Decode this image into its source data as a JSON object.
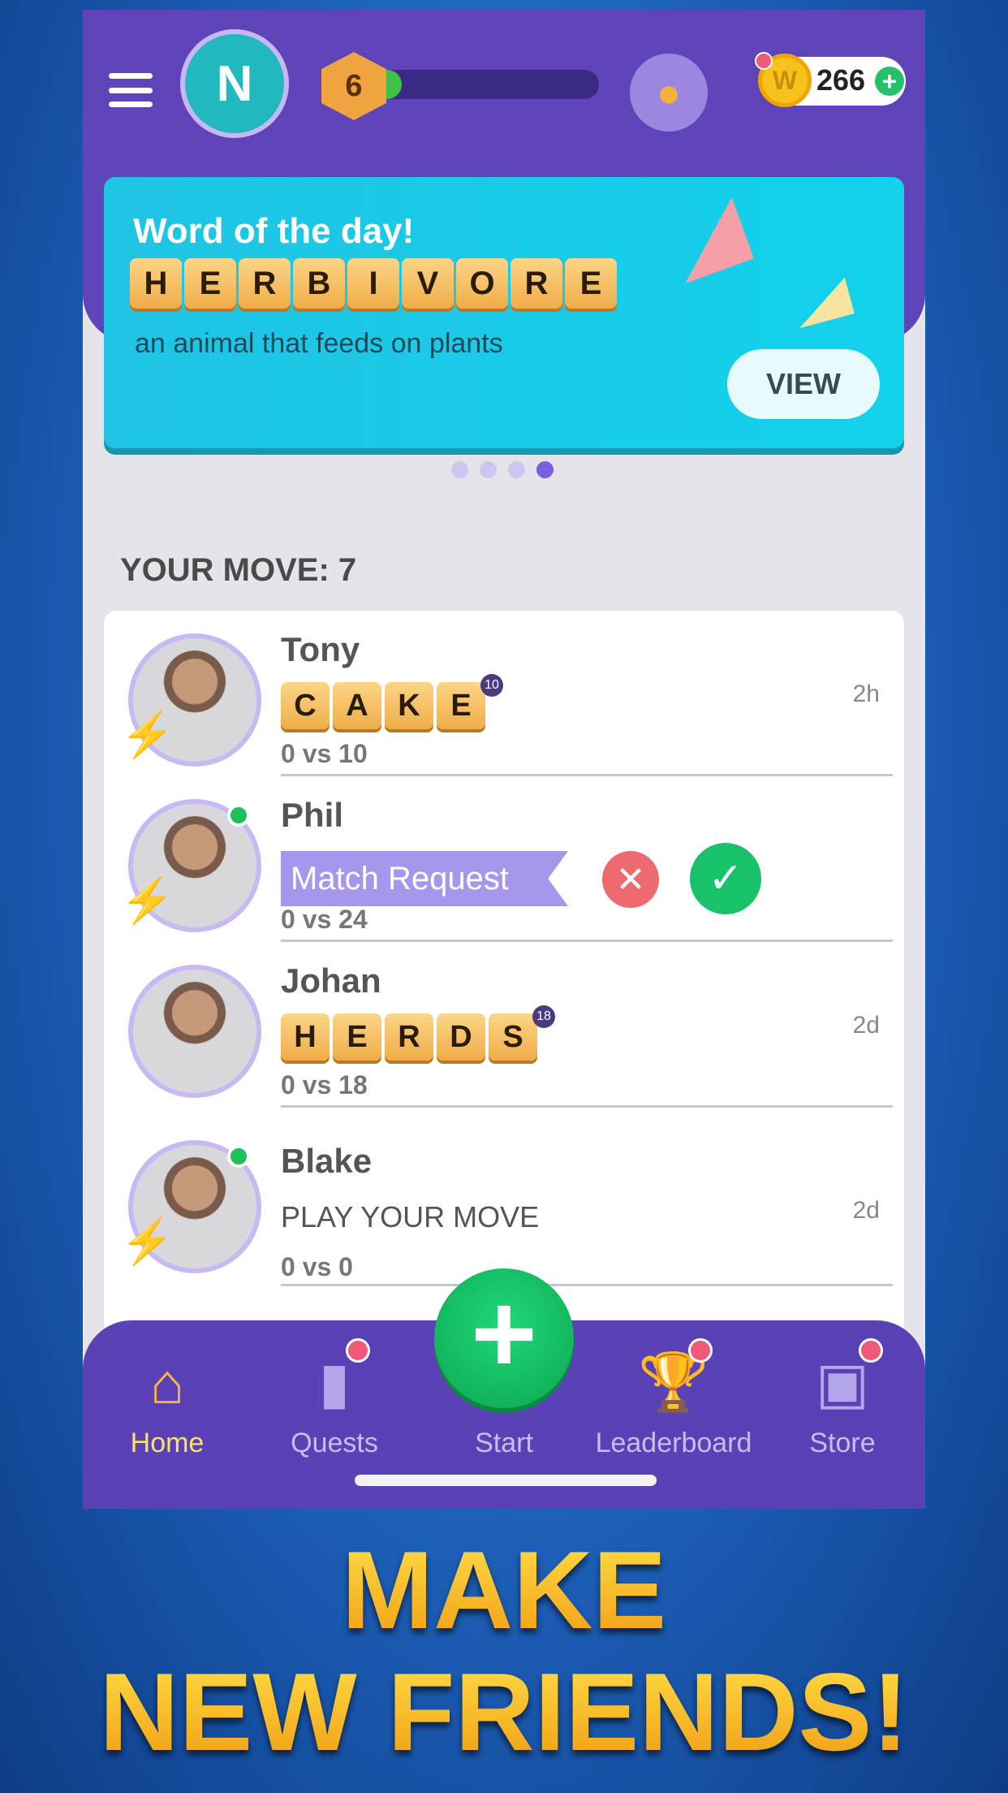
{
  "header": {
    "avatar_initial": "N",
    "level": "6",
    "level_progress": 0.15,
    "coins": "266",
    "coin_symbol": "W",
    "plus": "+"
  },
  "banner": {
    "title": "Word of the day!",
    "word": [
      "H",
      "E",
      "R",
      "B",
      "I",
      "V",
      "O",
      "R",
      "E"
    ],
    "definition": "an animal that feeds on plants",
    "view_label": "VIEW",
    "page_count": 4,
    "active_page": 4
  },
  "your_move": "YOUR MOVE: 7",
  "games": [
    {
      "name": "Tony",
      "word": [
        "C",
        "A",
        "K",
        "E"
      ],
      "word_score": "10",
      "score": "0 vs 10",
      "time": "2h",
      "online": false,
      "bolt": "#f4b62a"
    },
    {
      "name": "Phil",
      "status": "Match Request",
      "score": "0 vs 24",
      "online": true,
      "bolt": "#f4b62a",
      "reject": "✕",
      "accept": "✓"
    },
    {
      "name": "Johan",
      "word": [
        "H",
        "E",
        "R",
        "D",
        "S"
      ],
      "word_score": "18",
      "score": "0 vs 18",
      "time": "2d",
      "online": false
    },
    {
      "name": "Blake",
      "status": "PLAY YOUR MOVE",
      "score": "0 vs 0",
      "time": "2d",
      "online": true,
      "bolt": "#7a3ae0"
    }
  ],
  "bottom_nav": {
    "items": [
      {
        "label": "Home",
        "icon": "home-icon",
        "active": true
      },
      {
        "label": "Quests",
        "icon": "book-icon"
      },
      {
        "label": "Start",
        "icon": "plus-icon"
      },
      {
        "label": "Leaderboard",
        "icon": "trophy-icon"
      },
      {
        "label": "Store",
        "icon": "bag-icon"
      }
    ],
    "start_symbol": "+"
  },
  "promo": {
    "line1": "MAKE",
    "line2": "NEW FRIENDS!"
  },
  "colors": {
    "header": "#5e44b8",
    "banner": "#20c4e4",
    "accent_green": "#18c26a",
    "tile": "#f0ad48"
  }
}
